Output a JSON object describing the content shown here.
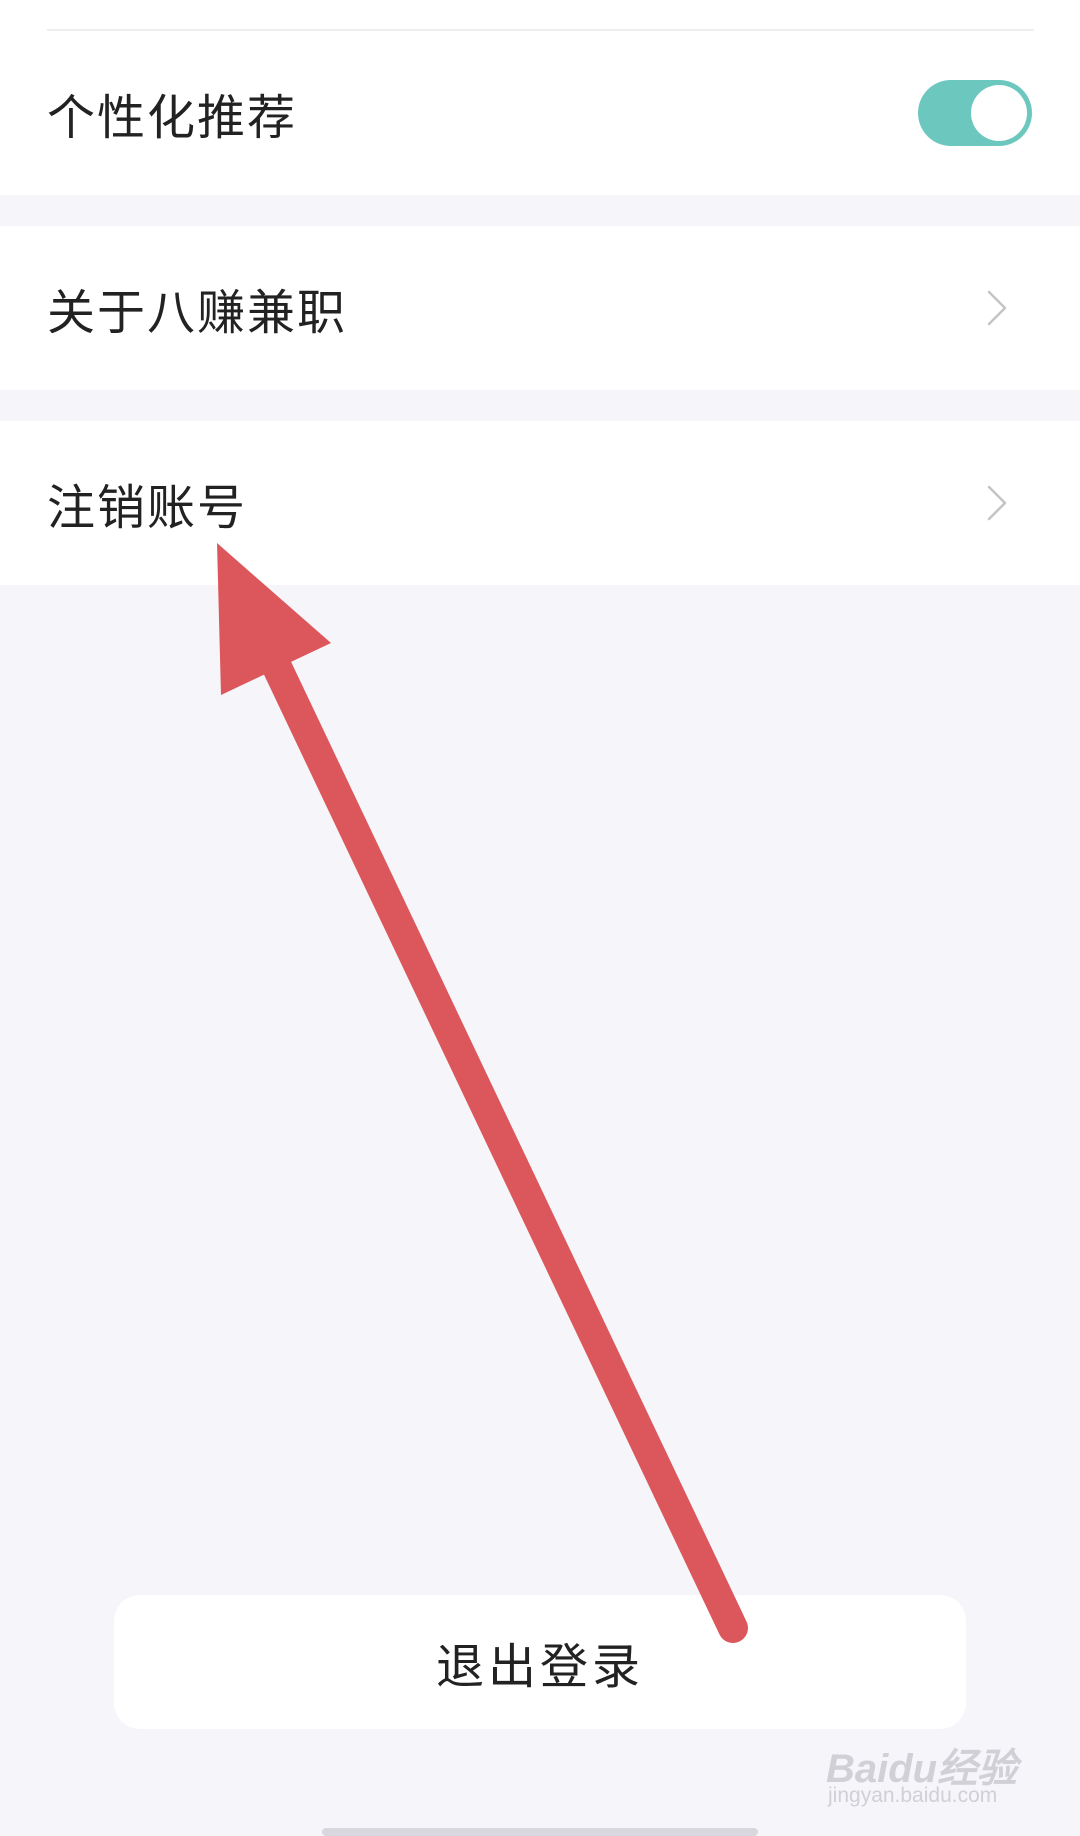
{
  "settings": {
    "personalized_recommendation": {
      "label": "个性化推荐",
      "enabled": true
    },
    "about": {
      "label": "关于八赚兼职"
    },
    "cancel_account": {
      "label": "注销账号"
    }
  },
  "logout": {
    "label": "退出登录"
  },
  "annotation": {
    "arrow_color": "#dc575c"
  },
  "watermark": {
    "brand": "Baidu经验",
    "url": "jingyan.baidu.com"
  },
  "colors": {
    "toggle_on": "#6cc7bf",
    "background": "#f5f5fa",
    "chevron": "#c4c4c4"
  }
}
